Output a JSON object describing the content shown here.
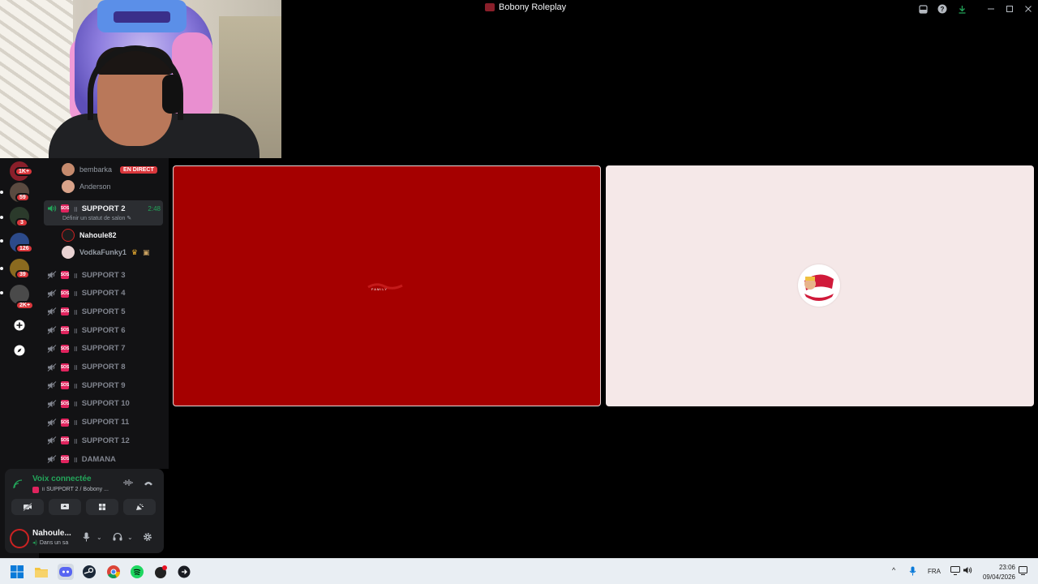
{
  "window": {
    "title": "Bobony Roleplay"
  },
  "rail": {
    "badges": [
      "1K+",
      "59",
      "3",
      "126",
      "39",
      "2K+"
    ]
  },
  "channels": {
    "members_top": [
      {
        "name": "bembarka",
        "badge": "EN DIRECT"
      },
      {
        "name": "Anderson"
      }
    ],
    "active": {
      "bar": "॥",
      "name": "SUPPORT 2",
      "timer": "2:48",
      "status": "Définir un statut de salon"
    },
    "active_members": [
      {
        "name": "Nahoule82"
      },
      {
        "name": "VodkaFunky1"
      }
    ],
    "list": [
      {
        "bar": "॥",
        "name": "SUPPORT 3"
      },
      {
        "bar": "॥",
        "name": "SUPPORT 4"
      },
      {
        "bar": "॥",
        "name": "SUPPORT 5"
      },
      {
        "bar": "॥",
        "name": "SUPPORT 6"
      },
      {
        "bar": "॥",
        "name": "SUPPORT 7"
      },
      {
        "bar": "॥",
        "name": "SUPPORT 8"
      },
      {
        "bar": "॥",
        "name": "SUPPORT 9"
      },
      {
        "bar": "॥",
        "name": "SUPPORT 10"
      },
      {
        "bar": "॥",
        "name": "SUPPORT 11"
      },
      {
        "bar": "॥",
        "name": "SUPPORT 12"
      },
      {
        "bar": "॥",
        "name": "DAMANA"
      }
    ]
  },
  "voice": {
    "title": "Voix connectée",
    "subtitle": "॥ SUPPORT 2 / Bobony ..."
  },
  "user": {
    "name": "Nahoule...",
    "status": "Dans un sa"
  },
  "stage": {
    "left_caption": "FAMILY"
  },
  "taskbar": {
    "lang": "FRA",
    "time": "23:06",
    "date": "09/04/2026"
  },
  "colors": {
    "online_green": "#23a55a",
    "live_red": "#da373c",
    "left_tile": "#a50000",
    "right_tile": "#f5e8e8"
  }
}
